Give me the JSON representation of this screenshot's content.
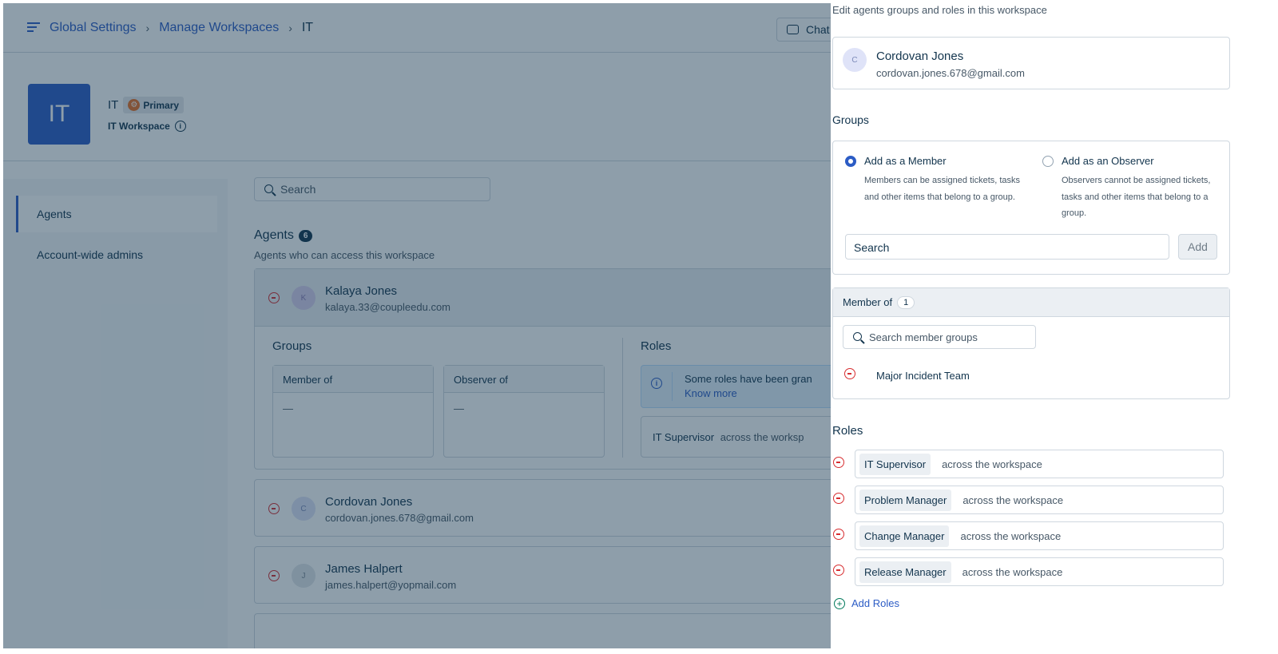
{
  "background": {
    "breadcrumb": {
      "items": [
        "Global Settings",
        "Manage Workspaces"
      ],
      "current": "IT"
    },
    "chat_label": "Chat",
    "workspace": {
      "logo": "IT",
      "name": "IT",
      "badge": "Primary",
      "subtitle": "IT Workspace"
    },
    "sidebar": {
      "items": [
        {
          "label": "Agents"
        },
        {
          "label": "Account-wide admins"
        }
      ]
    },
    "search_placeholder": "Search",
    "agents": {
      "title": "Agents",
      "count": "6",
      "subtitle": "Agents who can access this workspace",
      "list": [
        {
          "initial": "K",
          "name": "Kalaya Jones",
          "email": "kalaya.33@coupleedu.com"
        },
        {
          "initial": "C",
          "name": "Cordovan Jones",
          "email": "cordovan.jones.678@gmail.com"
        },
        {
          "initial": "J",
          "name": "James Halpert",
          "email": "james.halpert@yopmail.com"
        }
      ]
    },
    "expanded": {
      "groups_label": "Groups",
      "member_of": "Member of",
      "observer_of": "Observer of",
      "empty": "—",
      "roles_label": "Roles",
      "notice": "Some roles have been gran",
      "know_more": "Know more",
      "role": "IT Supervisor",
      "role_scope": "across the worksp"
    }
  },
  "panel": {
    "description": "Edit agents groups and roles in this workspace",
    "agent": {
      "initial": "C",
      "name": "Cordovan Jones",
      "email": "cordovan.jones.678@gmail.com"
    },
    "groups_heading": "Groups",
    "member_option": {
      "title": "Add as a Member",
      "desc": "Members can be assigned tickets, tasks and other items that belong to a group."
    },
    "observer_option": {
      "title": "Add as an Observer",
      "desc": "Observers cannot be assigned tickets, tasks and other items that belong to a group."
    },
    "group_search": "Search",
    "add_label": "Add",
    "member_of": {
      "label": "Member of",
      "count": "1",
      "search_placeholder": "Search member groups",
      "items": [
        "Major Incident Team"
      ]
    },
    "roles_heading": "Roles",
    "roles": [
      {
        "name": "IT Supervisor",
        "scope": "across the workspace"
      },
      {
        "name": "Problem Manager",
        "scope": "across the workspace"
      },
      {
        "name": "Change Manager",
        "scope": "across the workspace"
      },
      {
        "name": "Release Manager",
        "scope": "across the workspace"
      }
    ],
    "add_roles": "Add Roles"
  },
  "colors": {
    "accent": "#2c5cc5",
    "danger": "#d72d30",
    "overlay": "#12344d"
  }
}
